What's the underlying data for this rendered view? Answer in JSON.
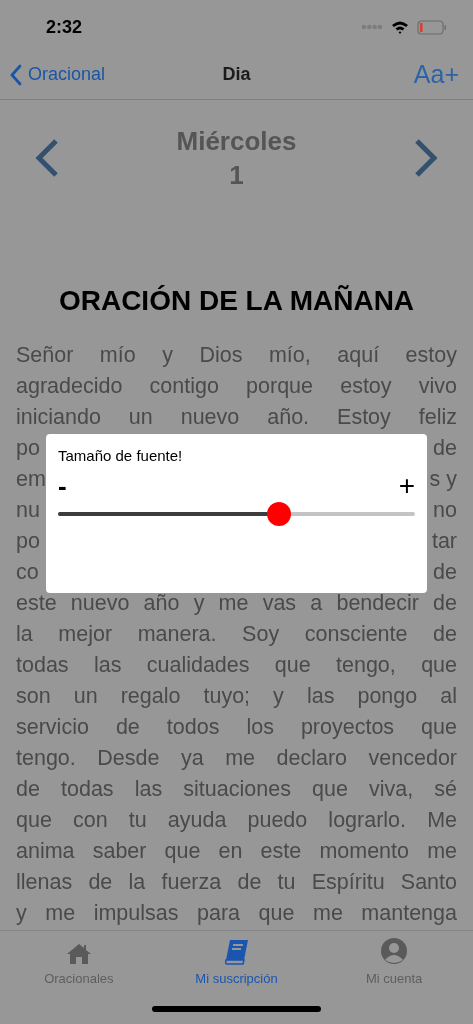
{
  "status_bar": {
    "time": "2:32"
  },
  "nav_bar": {
    "back": "Oracional",
    "title": "Dia",
    "action": "Aa+"
  },
  "day": {
    "weekday": "Miércoles",
    "number": "1"
  },
  "heading": "ORACIÓN DE LA MAÑANA",
  "lines": [
    {
      "kind": "full",
      "text": "Señor mío y Dios mío, aquí estoy"
    },
    {
      "kind": "full",
      "text": "agradecido contigo porque estoy vivo"
    },
    {
      "kind": "full",
      "text": "iniciando un nuevo año. Estoy feliz"
    },
    {
      "kind": "cut",
      "left": "po",
      "right": "de"
    },
    {
      "kind": "cut",
      "left": "em",
      "right": "s y"
    },
    {
      "kind": "cut",
      "left": "nu",
      "right": "no"
    },
    {
      "kind": "cut",
      "left": "po",
      "right": "tar"
    },
    {
      "kind": "cut",
      "left": "co",
      "right": "de"
    },
    {
      "kind": "full",
      "text": "este nuevo año y me vas a bendecir de"
    },
    {
      "kind": "full",
      "text": "la mejor manera.  Soy consciente de"
    },
    {
      "kind": "full",
      "text": "todas las cualidades que tengo, que"
    },
    {
      "kind": "full",
      "text": "son un regalo tuyo; y las pongo al"
    },
    {
      "kind": "full",
      "text": "servicio de todos los proyectos que"
    },
    {
      "kind": "full",
      "text": "tengo. Desde ya me declaro vencedor"
    },
    {
      "kind": "full",
      "text": "de todas las situaciones que viva, sé"
    },
    {
      "kind": "full",
      "text": "que con tu ayuda puedo lograrlo. Me"
    },
    {
      "kind": "full",
      "text": "anima saber que en este momento me"
    },
    {
      "kind": "full",
      "text": "llenas de la fuerza de tu Espíritu Santo"
    },
    {
      "kind": "full",
      "text": "y me impulsas para que me mantenga"
    }
  ],
  "font_dialog": {
    "title": "Tamaño de fuente!",
    "min_label": "-",
    "max_label": "+",
    "level": 0.62
  },
  "tabs": [
    {
      "label": "Oracionales",
      "selected": false
    },
    {
      "label": "Mi suscripción",
      "selected": true
    },
    {
      "label": "Mi cuenta",
      "selected": false
    }
  ]
}
